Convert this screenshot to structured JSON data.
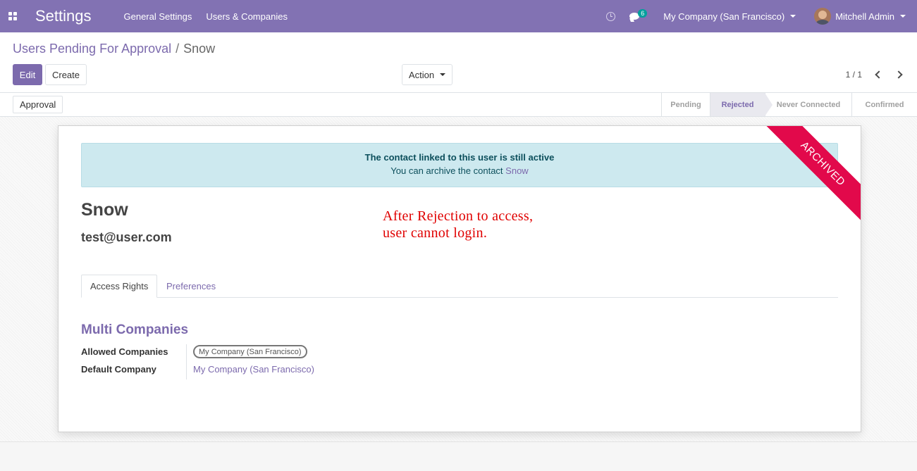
{
  "navbar": {
    "app_title": "Settings",
    "menu": [
      "General Settings",
      "Users & Companies"
    ],
    "chat_count": "6",
    "company": "My Company (San Francisco)",
    "user": "Mitchell Admin"
  },
  "control_panel": {
    "breadcrumb_parent": "Users Pending For Approval",
    "breadcrumb_separator": "/",
    "breadcrumb_current": "Snow",
    "edit_label": "Edit",
    "create_label": "Create",
    "action_label": "Action",
    "pager": "1 / 1"
  },
  "statusbar": {
    "approval_label": "Approval",
    "stages": [
      {
        "label": "Pending",
        "active": false
      },
      {
        "label": "Rejected",
        "active": true
      },
      {
        "label": "Never Connected",
        "active": false
      },
      {
        "label": "Confirmed",
        "active": false
      }
    ]
  },
  "sheet": {
    "alert_title": "The contact linked to this user is still active",
    "alert_text": "You can archive the contact",
    "alert_link": "Snow",
    "ribbon": "ARCHIVED",
    "name": "Snow",
    "email": "test@user.com",
    "annotation_line1": "After Rejection to access,",
    "annotation_line2": "user cannot login.",
    "tabs": [
      "Access Rights",
      "Preferences"
    ],
    "section_title": "Multi Companies",
    "allowed_companies_label": "Allowed Companies",
    "allowed_companies_tag": "My Company (San Francisco)",
    "default_company_label": "Default Company",
    "default_company_value": "My Company (San Francisco)"
  },
  "colors": {
    "navbar": "#8272b3",
    "accent": "#7c6aad",
    "ribbon": "#e2094b",
    "annotation": "#e00000",
    "alert_bg": "#cde9ef"
  }
}
